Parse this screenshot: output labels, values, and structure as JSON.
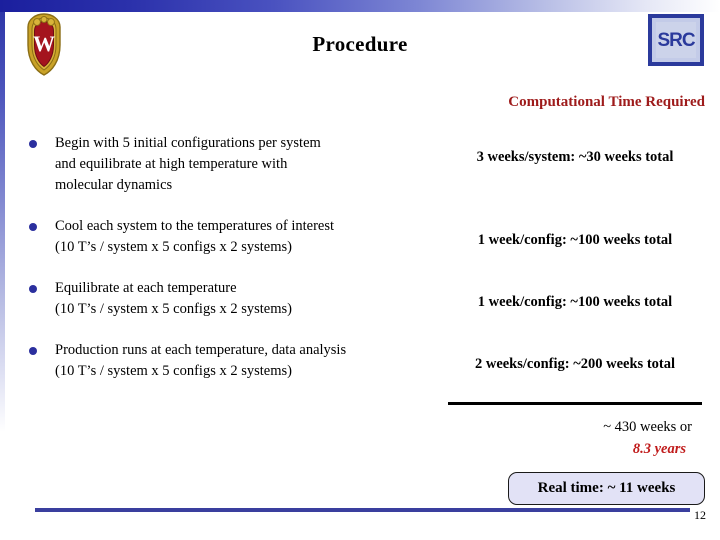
{
  "slide": {
    "title": "Procedure",
    "page_number": "12",
    "subheading": "Computational Time Required",
    "accent_red": "#9e1b1b",
    "accent_blue": "#2b2f9e",
    "footer_line_color": "#3a3f9e"
  },
  "logos": {
    "university_crest": "uw-crest-logo",
    "src_label": "SRC"
  },
  "rows": [
    {
      "line1": "Begin with 5 initial configurations per system",
      "line2": "and equilibrate at high temperature with",
      "line3": "molecular dynamics",
      "time": "3 weeks/system: ~30 weeks total"
    },
    {
      "line1": "Cool each system to the temperatures of interest",
      "line2": "(10 T’s / system x 5 configs x 2 systems)",
      "line3": "",
      "time": "1 week/config:  ~100 weeks total"
    },
    {
      "line1": "Equilibrate at each temperature",
      "line2": "(10 T’s / system x 5 configs x 2 systems)",
      "line3": "",
      "time": "1 week/config:  ~100 weeks total"
    },
    {
      "line1": "Production runs at each temperature, data analysis",
      "line2": "(10 T’s / system x 5 configs x 2 systems)",
      "line3": "",
      "time": "2 weeks/config:  ~200 weeks total"
    }
  ],
  "totals": {
    "weeks": "~ 430 weeks or",
    "years": "8.3 years",
    "realtime": "Real time:  ~ 11 weeks"
  }
}
